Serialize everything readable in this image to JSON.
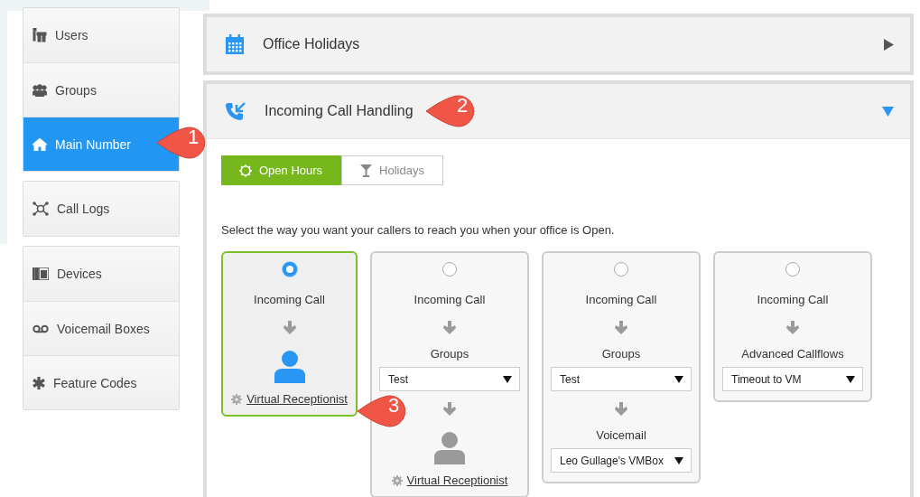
{
  "sidebar": {
    "groups": [
      {
        "items": [
          {
            "label": "Users",
            "selected": false
          },
          {
            "label": "Groups",
            "selected": false
          },
          {
            "label": "Main Number",
            "selected": true
          }
        ]
      },
      {
        "items": [
          {
            "label": "Call Logs",
            "selected": false
          }
        ]
      },
      {
        "items": [
          {
            "label": "Devices",
            "selected": false
          },
          {
            "label": "Voicemail Boxes",
            "selected": false
          },
          {
            "label": "Feature Codes",
            "selected": false
          }
        ]
      }
    ]
  },
  "panels": [
    {
      "title": "Office Holidays",
      "expanded": false
    },
    {
      "title": "Incoming Call Handling",
      "expanded": true,
      "tabs": [
        {
          "label": "Open Hours",
          "selected": true
        },
        {
          "label": "Holidays",
          "selected": false
        }
      ],
      "instructions": "Select the way you want your callers to reach you when your office is Open.",
      "options": [
        {
          "selected": true,
          "steps": [
            {
              "kind": "label",
              "text": "Incoming Call"
            },
            {
              "kind": "arrow"
            },
            {
              "kind": "receptionist",
              "link": "Virtual Receptionist"
            }
          ]
        },
        {
          "selected": false,
          "steps": [
            {
              "kind": "label",
              "text": "Incoming Call"
            },
            {
              "kind": "arrow"
            },
            {
              "kind": "label",
              "text": "Groups"
            },
            {
              "kind": "select",
              "value": "Test"
            },
            {
              "kind": "arrow"
            },
            {
              "kind": "receptionist",
              "link": "Virtual Receptionist"
            }
          ]
        },
        {
          "selected": false,
          "steps": [
            {
              "kind": "label",
              "text": "Incoming Call"
            },
            {
              "kind": "arrow"
            },
            {
              "kind": "label",
              "text": "Groups"
            },
            {
              "kind": "select",
              "value": "Test"
            },
            {
              "kind": "arrow"
            },
            {
              "kind": "label",
              "text": "Voicemail"
            },
            {
              "kind": "select",
              "value": "Leo Gullage's VMBox"
            }
          ]
        },
        {
          "selected": false,
          "steps": [
            {
              "kind": "label",
              "text": "Incoming Call"
            },
            {
              "kind": "arrow"
            },
            {
              "kind": "label",
              "text": "Advanced Callflows"
            },
            {
              "kind": "select",
              "value": "Timeout to VM"
            }
          ]
        }
      ]
    }
  ],
  "callouts": [
    "1",
    "2",
    "3"
  ]
}
